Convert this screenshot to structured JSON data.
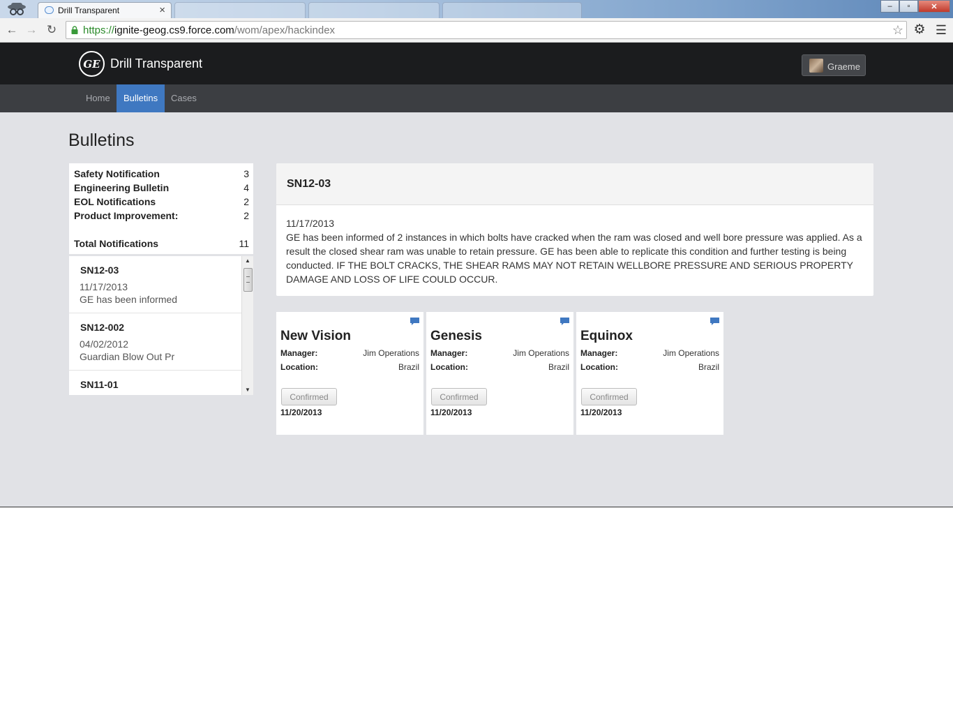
{
  "browser": {
    "tab_title": "Drill Transparent",
    "tab_close": "×",
    "url_scheme": "https://",
    "url_host": "ignite-geog.cs9.force.com",
    "url_path": "/wom/apex/hackindex",
    "window_controls": [
      "–",
      "▫",
      "✕"
    ]
  },
  "header": {
    "logo_text": "GE",
    "app_title": "Drill Transparent",
    "user_name": "Graeme"
  },
  "nav": {
    "items": [
      "Home",
      "Bulletins",
      "Cases"
    ],
    "active": "Bulletins"
  },
  "page_title": "Bulletins",
  "counts": {
    "rows": [
      {
        "label": "Safety Notification",
        "count": "3"
      },
      {
        "label": "Engineering Bulletin",
        "count": "4"
      },
      {
        "label": "EOL Notifications",
        "count": "2"
      },
      {
        "label": "Product Improvement:",
        "count": "2"
      }
    ],
    "total_label": "Total Notifications",
    "total_count": "11"
  },
  "bulletin_list": [
    {
      "code": "SN12-03",
      "date": "11/17/2013",
      "snippet": "GE has been informed"
    },
    {
      "code": "SN12-002",
      "date": "04/02/2012",
      "snippet": "Guardian Blow Out Pr"
    },
    {
      "code": "SN11-01",
      "date": "",
      "snippet": ""
    }
  ],
  "detail": {
    "code": "SN12-03",
    "date": "11/17/2013",
    "body": "GE has been informed of 2 instances in which bolts have cracked when the ram was closed and well bore pressure was applied. As a result the closed shear ram was unable to retain pressure. GE has been able to replicate this condition and further testing is being conducted. IF THE BOLT CRACKS, THE SHEAR RAMS MAY NOT RETAIN WELLBORE PRESSURE AND SERIOUS PROPERTY DAMAGE AND LOSS OF LIFE COULD OCCUR."
  },
  "rigs": [
    {
      "name": "New Vision",
      "manager_label": "Manager:",
      "manager": "Jim Operations",
      "location_label": "Location:",
      "location": "Brazil",
      "button": "Confirmed",
      "date": "11/20/2013"
    },
    {
      "name": "Genesis",
      "manager_label": "Manager:",
      "manager": "Jim Operations",
      "location_label": "Location:",
      "location": "Brazil",
      "button": "Confirmed",
      "date": "11/20/2013"
    },
    {
      "name": "Equinox",
      "manager_label": "Manager:",
      "manager": "Jim Operations",
      "location_label": "Location:",
      "location": "Brazil",
      "button": "Confirmed",
      "date": "11/20/2013"
    }
  ],
  "colors": {
    "accent": "#3f78c1",
    "header_bg": "#1b1c1e",
    "nav_bg": "#3c3e42",
    "page_bg": "#e1e2e6"
  }
}
